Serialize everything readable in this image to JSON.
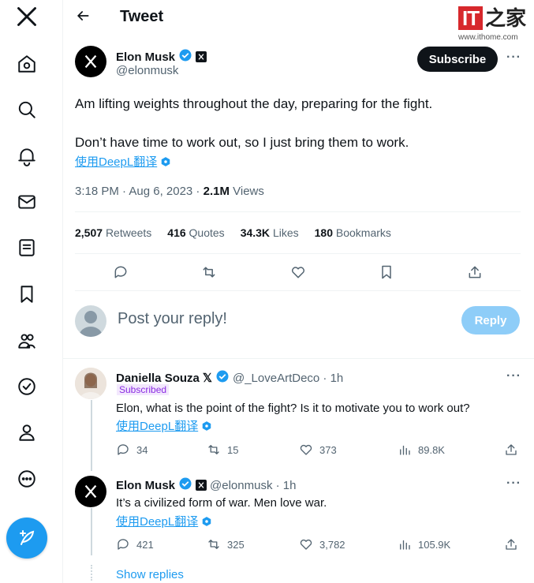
{
  "page": {
    "header_title": "Tweet"
  },
  "watermark": {
    "logo_it": "IT",
    "logo_zh": "之家",
    "url": "www.ithome.com"
  },
  "sidebar": {
    "items": [
      "x-logo-icon",
      "home-icon",
      "explore-icon",
      "notifications-icon",
      "messages-icon",
      "lists-icon",
      "bookmarks-icon",
      "communities-icon",
      "verified-icon",
      "profile-icon",
      "more-icon"
    ]
  },
  "tweet": {
    "author_name": "Elon Musk",
    "author_handle": "@elonmusk",
    "subscribe_label": "Subscribe",
    "line1": "Am lifting weights throughout the day, preparing for the fight.",
    "line2": "Don’t have time to work out, so I just bring them to work.",
    "translate": "使用DeepL翻译",
    "time": "3:18 PM · Aug 6, 2023 · ",
    "views_count": "2.1M",
    "views_label": " Views",
    "stats": {
      "retweets_count": "2,507",
      "retweets_label": "Retweets",
      "quotes_count": "416",
      "quotes_label": "Quotes",
      "likes_count": "34.3K",
      "likes_label": "Likes",
      "bookmarks_count": "180",
      "bookmarks_label": "Bookmarks"
    }
  },
  "reply_box": {
    "placeholder": "Post your reply!",
    "button": "Reply"
  },
  "replies": [
    {
      "name": "Daniella Souza",
      "handle": "@_LoveArtDeco · 1h",
      "badge": "Subscribed",
      "text": "Elon, what is the point of the fight? Is it to motivate you to work out?",
      "translate": "使用DeepL翻译",
      "replies": "34",
      "retweets": "15",
      "likes": "373",
      "views": "89.8K"
    },
    {
      "name": "Elon Musk",
      "handle": "@elonmusk · 1h",
      "text": "It’s a civilized form of war. Men love war.",
      "translate": "使用DeepL翻译",
      "replies": "421",
      "retweets": "325",
      "likes": "3,782",
      "views": "105.9K"
    }
  ],
  "show_replies": "Show replies",
  "colors": {
    "accent": "#1d9bf0",
    "text": "#0f1419",
    "muted": "#536471"
  }
}
